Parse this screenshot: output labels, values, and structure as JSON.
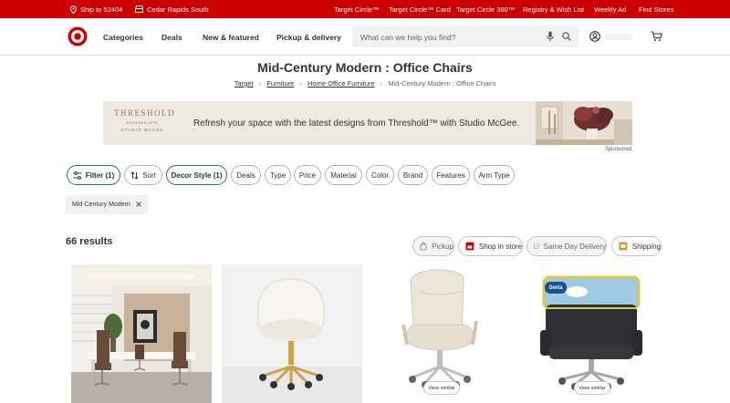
{
  "topbar": {
    "ship_to": "Ship to 52404",
    "store": "Cedar Rapids South",
    "links": [
      "Target Circle™",
      "Target Circle™ Card",
      "Target Circle 360™",
      "Registry & Wish List",
      "Weekly Ad",
      "Find Stores"
    ]
  },
  "header": {
    "nav": [
      "Categories",
      "Deals",
      "New & featured",
      "Pickup & delivery"
    ],
    "search_placeholder": "What can we help you find?",
    "icons": [
      "target-bullseye-logo",
      "microphone-icon",
      "search-icon",
      "account-icon",
      "cart-icon"
    ]
  },
  "page": {
    "title": "Mid-Century Modern : Office Chairs",
    "breadcrumb": [
      "Target",
      "Furniture",
      "Home Office Furniture",
      "Mid-Century Modern : Office Chairs"
    ]
  },
  "banner": {
    "brand": "THRESHOLD",
    "brand_small": "DESIGNED WITH",
    "brand_sub": "STUDIO MCGEE",
    "text": "Refresh your space with the latest designs from Threshold™ with Studio McGee.",
    "sponsored": "Sponsored"
  },
  "filters": {
    "chips": [
      "Filter (1)",
      "Sort",
      "Decor Style (1)",
      "Deals",
      "Type",
      "Price",
      "Material",
      "Color",
      "Brand",
      "Features",
      "Arm Type"
    ],
    "applied": "Mid-Century Modern"
  },
  "results": {
    "count": "66 results",
    "fulfillment": [
      "Pickup",
      "Shop in store",
      "Same Day Delivery",
      "Shipping"
    ]
  },
  "products": {
    "view_similar": "View similar",
    "mattress_brand": "Serta"
  },
  "colors": {
    "brand_red": "#cc0000",
    "active_green": "#2a7d3a"
  }
}
